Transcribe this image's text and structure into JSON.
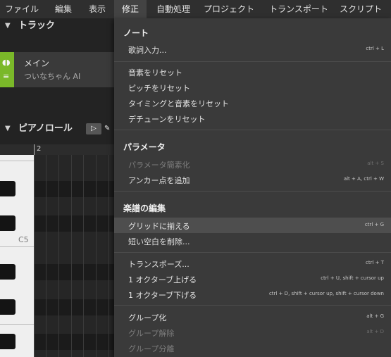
{
  "menubar": {
    "items": [
      "ファイル",
      "編集",
      "表示",
      "修正",
      "自動処理",
      "プロジェクト",
      "トランスポート",
      "スクリプト"
    ]
  },
  "track_panel": {
    "title": "トラック",
    "track": {
      "name": "メイン",
      "voice": "ついなちゃん AI",
      "color": "#7ab829"
    }
  },
  "piano_roll": {
    "title": "ピアノロール",
    "ruler_label": "2",
    "key_label": "C5"
  },
  "edit_menu": {
    "sections": [
      {
        "title": "ノート",
        "items": [
          {
            "label": "歌詞入力...",
            "shortcut": "ctrl + L"
          }
        ]
      },
      {
        "items": [
          {
            "label": "音素をリセット",
            "shortcut": ""
          },
          {
            "label": "ピッチをリセット",
            "shortcut": ""
          },
          {
            "label": "タイミングと音素をリセット",
            "shortcut": ""
          },
          {
            "label": "デチューンをリセット",
            "shortcut": ""
          }
        ]
      },
      {
        "title": "パラメータ",
        "items": [
          {
            "label": "パラメータ簡素化",
            "shortcut": "alt + S",
            "disabled": true
          },
          {
            "label": "アンカー点を追加",
            "shortcut": "alt + A, ctrl + W"
          }
        ]
      },
      {
        "title": "楽譜の編集",
        "items": [
          {
            "label": "グリッドに揃える",
            "shortcut": "ctrl + G",
            "highlighted": true
          },
          {
            "label": "短い空白を削除...",
            "shortcut": ""
          }
        ]
      },
      {
        "items": [
          {
            "label": "トランスポーズ...",
            "shortcut": "ctrl + T"
          },
          {
            "label": "1 オクターブ上げる",
            "shortcut": "ctrl + U, shift + cursor up"
          },
          {
            "label": "1 オクターブ下げる",
            "shortcut": "ctrl + D, shift + cursor up, shift + cursor down"
          }
        ]
      },
      {
        "items": [
          {
            "label": "グループ化",
            "shortcut": "alt + G"
          },
          {
            "label": "グループ解除",
            "shortcut": "alt + D",
            "disabled": true
          },
          {
            "label": "グループ分離",
            "shortcut": "",
            "disabled": true
          }
        ]
      }
    ]
  }
}
